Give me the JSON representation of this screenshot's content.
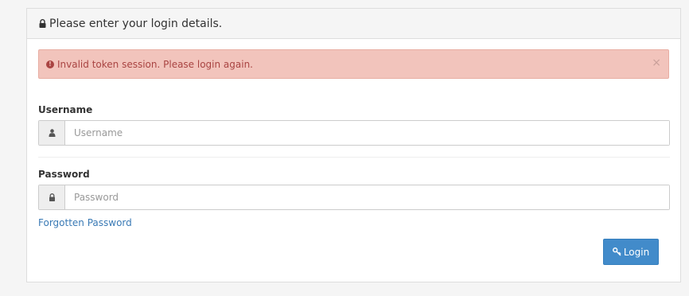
{
  "panel": {
    "heading": "Please enter your login details.",
    "heading_icon": "lock-icon"
  },
  "alert": {
    "message": "Invalid token session. Please login again.",
    "icon": "exclamation-circle-icon",
    "close": "×"
  },
  "form": {
    "username": {
      "label": "Username",
      "placeholder": "Username",
      "value": "",
      "icon": "user-icon"
    },
    "password": {
      "label": "Password",
      "placeholder": "Password",
      "value": "",
      "icon": "lock-icon"
    },
    "forgot_link": "Forgotten Password",
    "login_button": "Login",
    "login_icon": "key-icon"
  },
  "colors": {
    "page_bg": "#f5f5f5",
    "alert_bg": "#f2c4bc",
    "alert_text": "#a94442",
    "link": "#3a7ab5",
    "primary": "#428bca"
  }
}
